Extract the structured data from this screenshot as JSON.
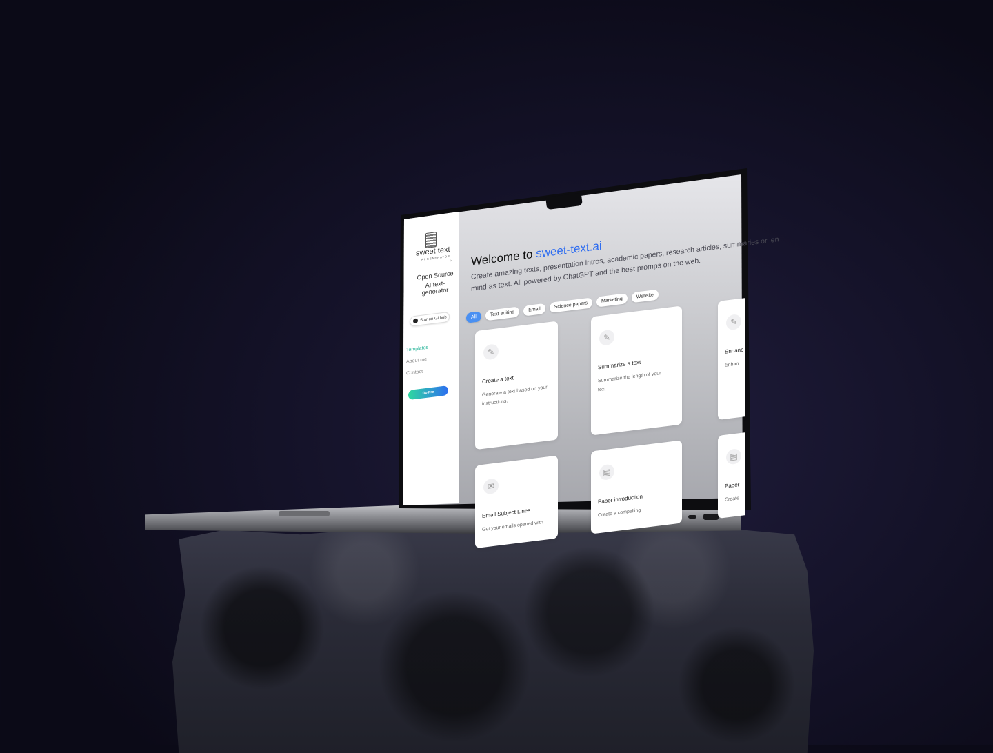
{
  "sidebar": {
    "brand": "sweet text",
    "brand_sub": "AI GENERATOR",
    "tagline_1": "Open Source",
    "tagline_2": "AI text-generator",
    "github_button": "Star on Github",
    "nav": [
      "Templates",
      "About me",
      "Contact"
    ],
    "cta": "Go Pro"
  },
  "main": {
    "title_prefix": "Welcome to",
    "title_brand": "sweet-text.ai",
    "description_line1": "Create amazing texts, presentation intros, academic papers, research articles, summaries or len",
    "description_line2": "mind as text. All powered by ChatGPT and the best promps on the web.",
    "tabs": [
      "All",
      "Text editing",
      "Email",
      "Science papers",
      "Marketing",
      "Website"
    ],
    "active_tab": "All",
    "cards": [
      {
        "title": "Create a text",
        "desc": "Generate a text based on your instructions.",
        "icon": "edit-icon"
      },
      {
        "title": "Summarize a text",
        "desc": "Summarize the length of your text.",
        "icon": "edit-icon"
      },
      {
        "title": "Enhanc",
        "desc": "Enhan",
        "icon": "edit-icon"
      },
      {
        "title": "Email Subject Lines",
        "desc": "Get your emails opened with",
        "icon": "mail-icon"
      },
      {
        "title": "Paper introduction",
        "desc": "Create a compelling",
        "icon": "document-icon"
      },
      {
        "title": "Paper",
        "desc": "Create",
        "icon": "document-icon"
      }
    ]
  },
  "colors": {
    "accent": "#2f6df0",
    "active_tab": "#4a90f2",
    "nav_active": "#2bb69b",
    "cta_start": "#2ed7a0",
    "cta_end": "#2d6ff0"
  }
}
